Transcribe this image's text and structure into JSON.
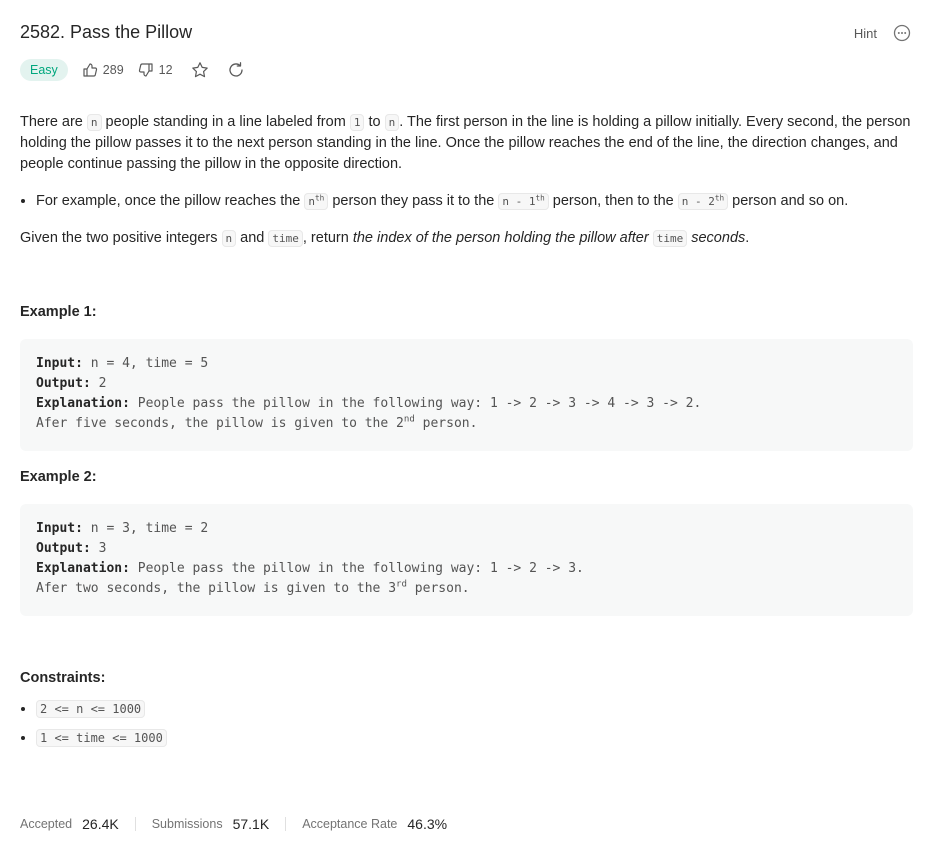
{
  "problem": {
    "title": "2582. Pass the Pillow",
    "difficulty": "Easy",
    "likes": "289",
    "dislikes": "12",
    "hint_label": "Hint"
  },
  "description": {
    "p1_a": "There are ",
    "p1_code1": "n",
    "p1_b": " people standing in a line labeled from ",
    "p1_code2": "1",
    "p1_c": " to ",
    "p1_code3": "n",
    "p1_d": ". The first person in the line is holding a pillow initially. Every second, the person holding the pillow passes it to the next person standing in the line. Once the pillow reaches the end of the line, the direction changes, and people continue passing the pillow in the opposite direction.",
    "bullet_a": "For example, once the pillow reaches the ",
    "bullet_code1": "n",
    "bullet_sup1": "th",
    "bullet_b": " person they pass it to the ",
    "bullet_code2": "n - 1",
    "bullet_sup2": "th",
    "bullet_c": " person, then to the ",
    "bullet_code3": "n - 2",
    "bullet_sup3": "th",
    "bullet_d": " person and so on.",
    "p2_a": "Given the two positive integers ",
    "p2_code1": "n",
    "p2_b": " and ",
    "p2_code2": "time",
    "p2_c": ", return ",
    "p2_em1": "the index of the person holding the pillow after ",
    "p2_code3": "time",
    "p2_em2": " seconds",
    "p2_d": "."
  },
  "examples": [
    {
      "title": "Example 1:",
      "input_label": "Input:",
      "input": " n = 4, time = 5",
      "output_label": "Output:",
      "output": " 2",
      "explanation_label": "Explanation:",
      "explanation": " People pass the pillow in the following way: 1 -> 2 -> 3 -> 4 -> 3 -> 2.",
      "line2_a": "Afer five seconds, the pillow is given to the 2",
      "line2_sup": "nd",
      "line2_b": " person."
    },
    {
      "title": "Example 2:",
      "input_label": "Input:",
      "input": " n = 3, time = 2",
      "output_label": "Output:",
      "output": " 3",
      "explanation_label": "Explanation:",
      "explanation": " People pass the pillow in the following way: 1 -> 2 -> 3.",
      "line2_a": "Afer two seconds, the pillow is given to the 3",
      "line2_sup": "rd",
      "line2_b": " person."
    }
  ],
  "constraints": {
    "title": "Constraints:",
    "items": [
      "2 <= n <= 1000",
      "1 <= time <= 1000"
    ]
  },
  "stats": {
    "accepted_label": "Accepted",
    "accepted": "26.4K",
    "submissions_label": "Submissions",
    "submissions": "57.1K",
    "rate_label": "Acceptance Rate",
    "rate": "46.3%"
  },
  "icons": {
    "like": "thumbs-up-icon",
    "dislike": "thumbs-down-icon",
    "favorite": "star-icon",
    "share": "refresh-icon",
    "more": "more-horizontal-icon"
  },
  "colors": {
    "easy_badge_bg": "#e3f3ef",
    "easy_badge_text": "#00a77d"
  }
}
